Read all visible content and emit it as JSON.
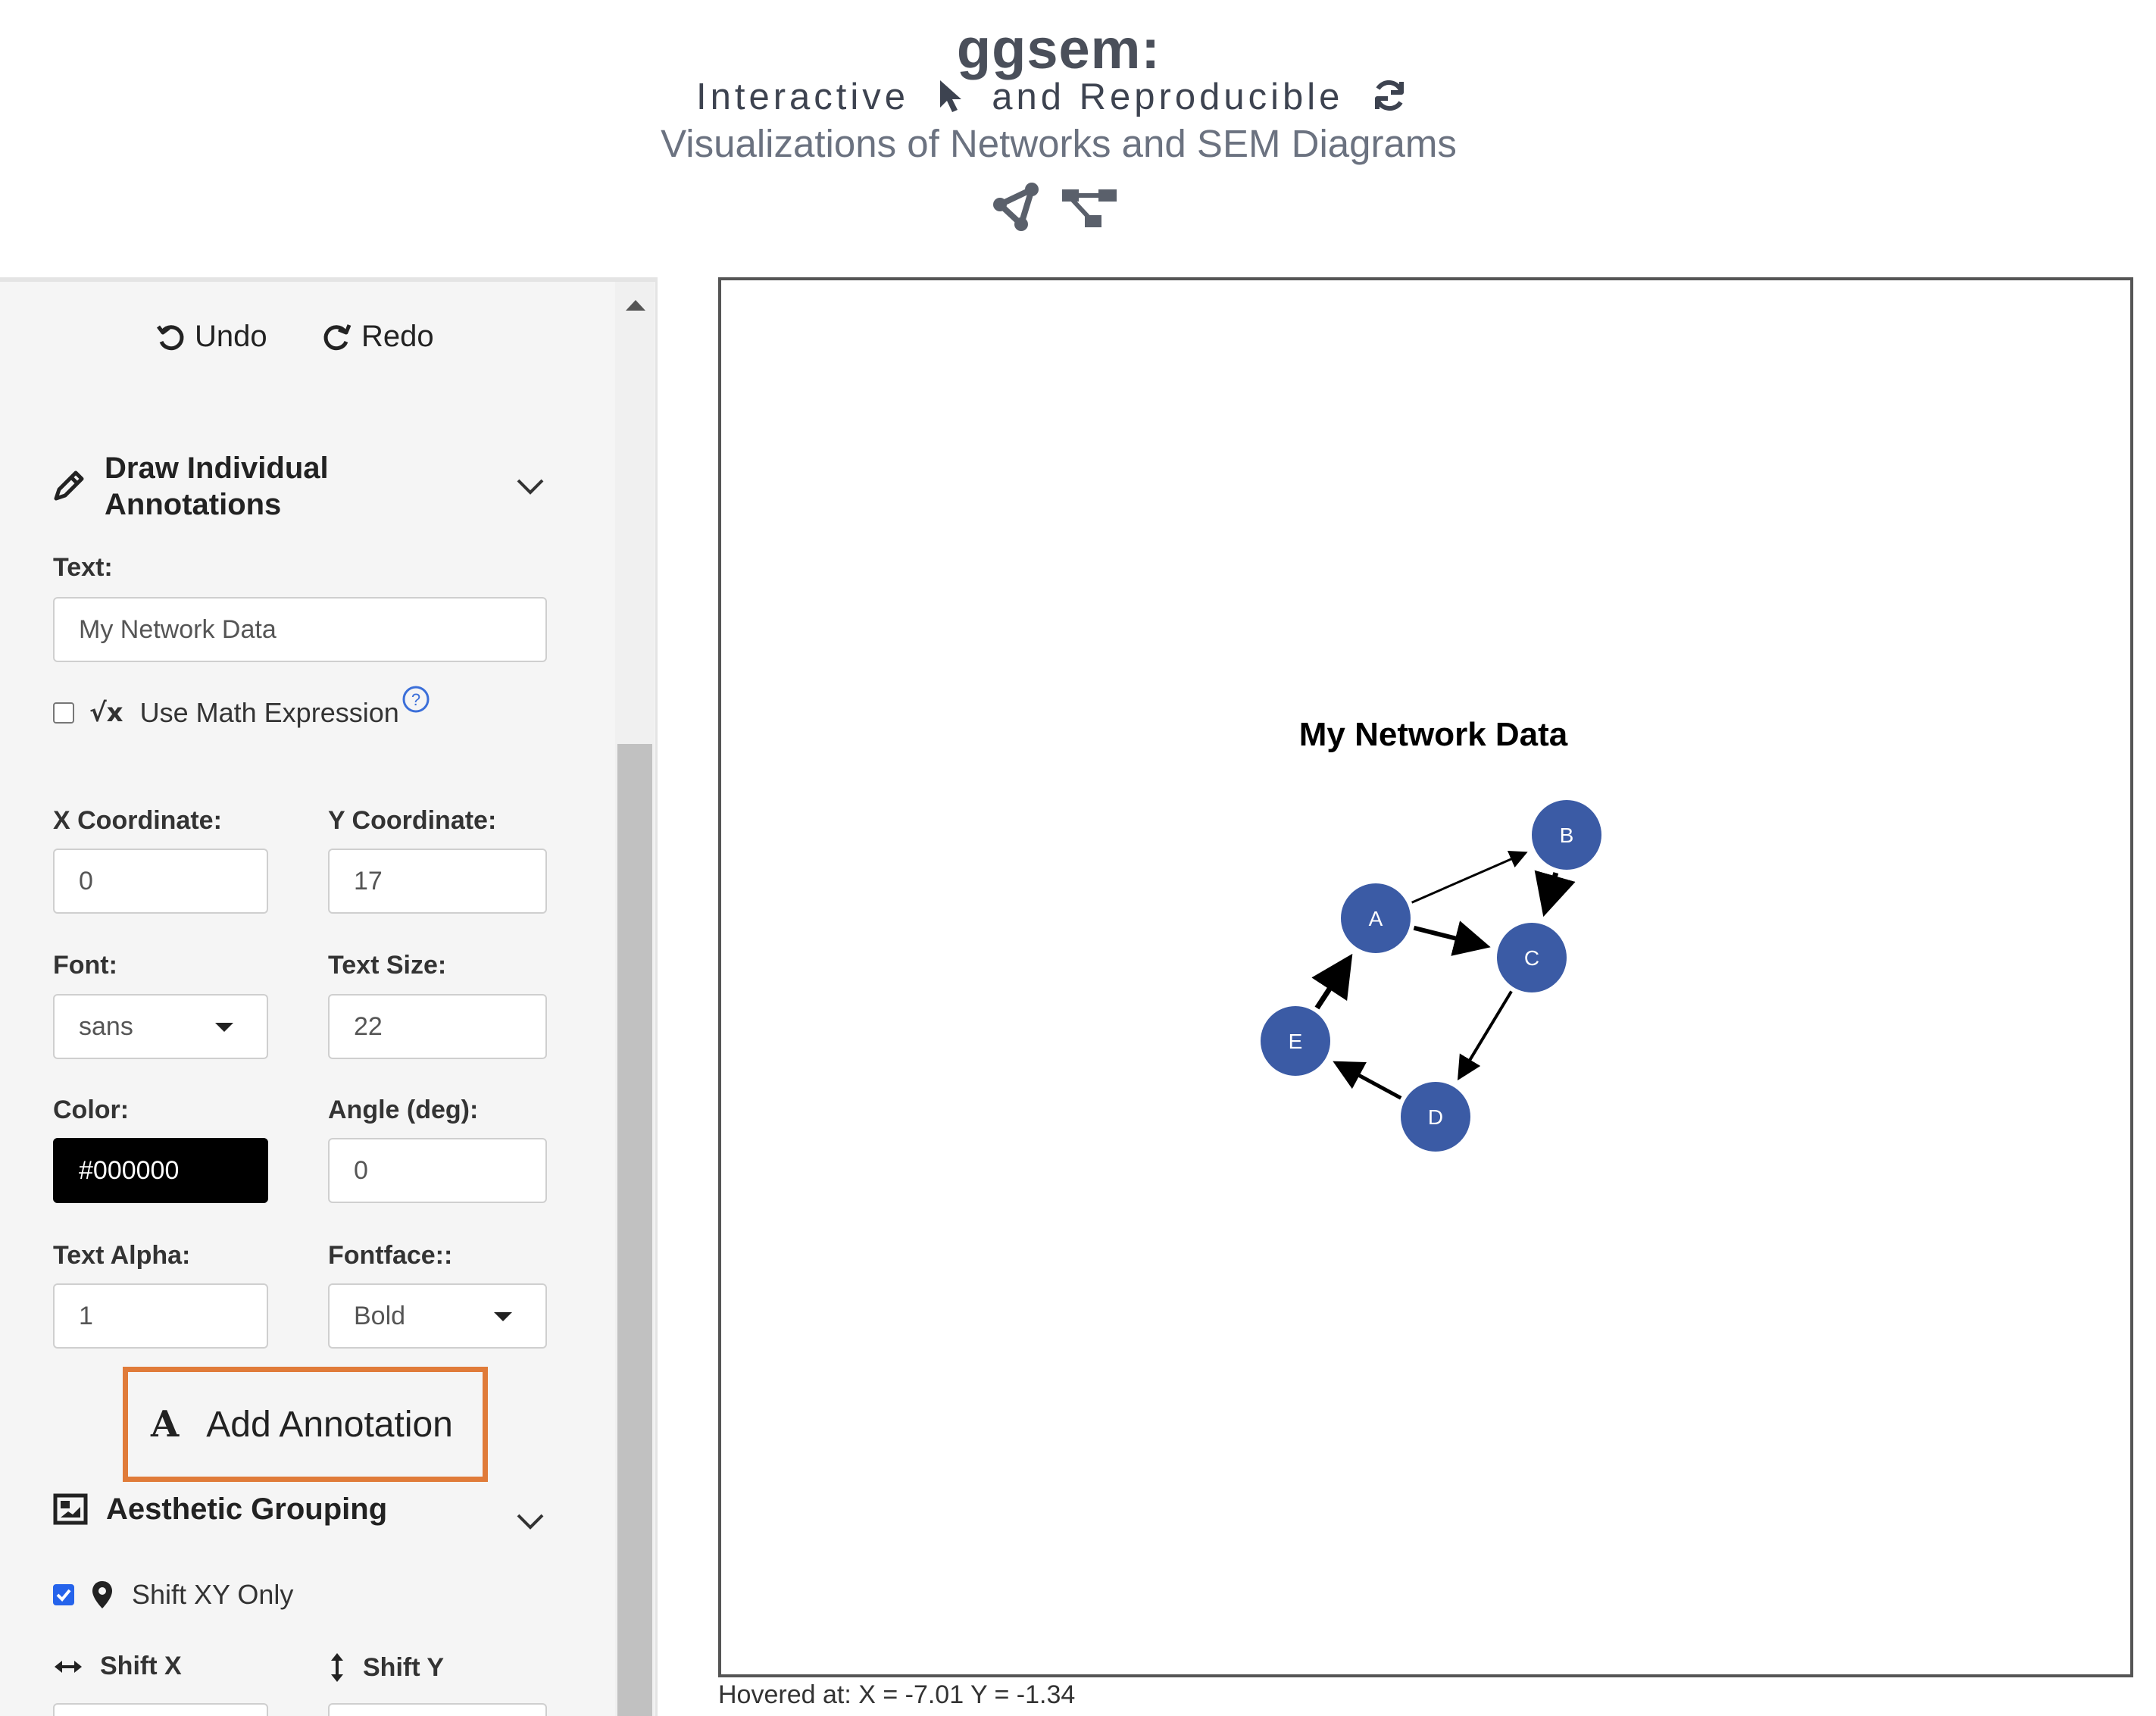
{
  "header": {
    "title": "ggsem:",
    "subtitle_part1": "Interactive",
    "subtitle_part2": "and Reproducible",
    "subtitle2": "Visualizations of Networks and SEM Diagrams",
    "icons": [
      "cursor-icon",
      "refresh-icon",
      "network-icon",
      "sem-diagram-icon"
    ]
  },
  "toolbar": {
    "undo_label": "Undo",
    "redo_label": "Redo"
  },
  "annotations_section": {
    "title_line1": "Draw Individual",
    "title_line2": "Annotations",
    "text_label": "Text:",
    "text_value": "My Network Data",
    "math_label": "Use Math Expression",
    "math_checked": false,
    "x_label": "X Coordinate:",
    "x_value": "0",
    "y_label": "Y Coordinate:",
    "y_value": "17",
    "font_label": "Font:",
    "font_value": "sans",
    "size_label": "Text Size:",
    "size_value": "22",
    "color_label": "Color:",
    "color_value": "#000000",
    "angle_label": "Angle (deg):",
    "angle_value": "0",
    "alpha_label": "Text Alpha:",
    "alpha_value": "1",
    "fontface_label": "Fontface::",
    "fontface_value": "Bold",
    "add_button_label": "Add Annotation"
  },
  "grouping_section": {
    "title": "Aesthetic Grouping",
    "shift_xy_label": "Shift XY Only",
    "shift_xy_checked": true,
    "shift_x_label": "Shift X",
    "shift_y_label": "Shift Y"
  },
  "plot": {
    "annotation_text": "My Network Data",
    "node_color": "#3b5ba5",
    "nodes": [
      {
        "id": "A",
        "label": "A"
      },
      {
        "id": "B",
        "label": "B"
      },
      {
        "id": "C",
        "label": "C"
      },
      {
        "id": "D",
        "label": "D"
      },
      {
        "id": "E",
        "label": "E"
      }
    ],
    "edges": [
      {
        "from": "A",
        "to": "B"
      },
      {
        "from": "A",
        "to": "C"
      },
      {
        "from": "B",
        "to": "C"
      },
      {
        "from": "C",
        "to": "D"
      },
      {
        "from": "D",
        "to": "E"
      },
      {
        "from": "E",
        "to": "A"
      }
    ]
  },
  "status": {
    "hover_text": "Hovered at: X = -7.01 Y = -1.34"
  }
}
